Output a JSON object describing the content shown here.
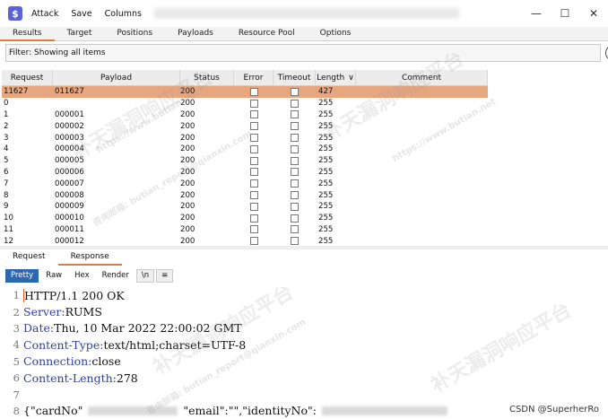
{
  "titlebar": {
    "app_icon": "$",
    "menu": [
      "Attack",
      "Save",
      "Columns"
    ]
  },
  "window_controls": {
    "minimize": "—",
    "maximize": "☐",
    "close": "✕"
  },
  "tabs": [
    "Results",
    "Target",
    "Positions",
    "Payloads",
    "Resource Pool",
    "Options"
  ],
  "filter": {
    "text": "Filter: Showing all items",
    "help": "?"
  },
  "table": {
    "headers": [
      "Request",
      "Payload",
      "Status",
      "Error",
      "Timeout",
      "Length",
      "Comment"
    ],
    "sort_indicator": "∨",
    "rows": [
      [
        "11627",
        "011627",
        "200",
        "427"
      ],
      [
        "0",
        "",
        "200",
        "255"
      ],
      [
        "1",
        "000001",
        "200",
        "255"
      ],
      [
        "2",
        "000002",
        "200",
        "255"
      ],
      [
        "3",
        "000003",
        "200",
        "255"
      ],
      [
        "4",
        "000004",
        "200",
        "255"
      ],
      [
        "5",
        "000005",
        "200",
        "255"
      ],
      [
        "6",
        "000006",
        "200",
        "255"
      ],
      [
        "7",
        "000007",
        "200",
        "255"
      ],
      [
        "8",
        "000008",
        "200",
        "255"
      ],
      [
        "9",
        "000009",
        "200",
        "255"
      ],
      [
        "10",
        "000010",
        "200",
        "255"
      ],
      [
        "11",
        "000011",
        "200",
        "255"
      ],
      [
        "12",
        "000012",
        "200",
        "255"
      ]
    ]
  },
  "response_tabs": [
    "Request",
    "Response"
  ],
  "view_buttons": [
    "Pretty",
    "Raw",
    "Hex",
    "Render",
    "\\n",
    "≡"
  ],
  "response_lines": [
    {
      "num": "1",
      "key": "",
      "val": "HTTP/1.1 200 OK"
    },
    {
      "num": "2",
      "key": "Server:",
      "val": " RUMS"
    },
    {
      "num": "3",
      "key": "Date:",
      "val": " Thu, 10 Mar 2022 22:00:02 GMT"
    },
    {
      "num": "4",
      "key": "Content-Type:",
      "val": " text/html;charset=UTF-8"
    },
    {
      "num": "5",
      "key": "Connection:",
      "val": " close"
    },
    {
      "num": "6",
      "key": "Content-Length:",
      "val": " 278"
    },
    {
      "num": "7",
      "key": "",
      "val": ""
    }
  ],
  "json_line": {
    "num": "8",
    "part1": "{\"cardNo\"",
    "part2": "\"email\":\"\",\"identityNo\":"
  },
  "watermarks": [
    "补天漏洞响应平台",
    "https://www.butian.net",
    "咨询邮箱: butian_report@qianxin.com"
  ],
  "footer": "CSDN @SuperherRo"
}
